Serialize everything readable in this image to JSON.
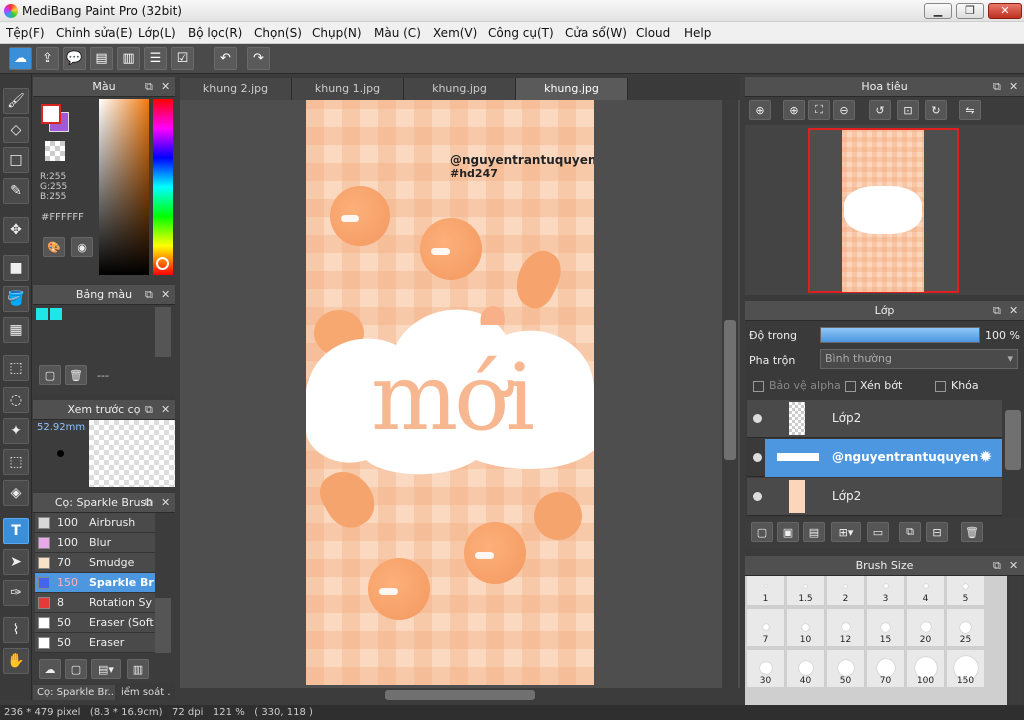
{
  "window": {
    "title": "MediBang Paint Pro (32bit)",
    "min": "▁",
    "max": "❐",
    "close": "✕"
  },
  "menu": [
    "Tệp(F)",
    "Chỉnh sửa(E)",
    "Lớp(L)",
    "Bộ lọc(R)",
    "Chọn(S)",
    "Chụp(N)",
    "Màu (C)",
    "Xem(V)",
    "Công cụ(T)",
    "Cửa sổ(W)",
    "Cloud",
    "Help"
  ],
  "tabs": [
    "khung 2.jpg",
    "khung 1.jpg",
    "khung.jpg",
    "khung.jpg"
  ],
  "colorPanel": {
    "title": "Màu",
    "r": "R:255",
    "g": "G:255",
    "b": "B:255",
    "hex": "#FFFFFF"
  },
  "palettePanel": {
    "title": "Bảng màu",
    "dash": "---"
  },
  "previewPanel": {
    "title": "Xem trước cọ",
    "size": "52.92mm"
  },
  "brushPanel": {
    "title": "Cọ: Sparkle Brush",
    "items": [
      {
        "size": "100",
        "name": "Airbrush",
        "color": "#d8d8d8"
      },
      {
        "size": "100",
        "name": "Blur",
        "color": "#e9a8e8"
      },
      {
        "size": "70",
        "name": "Smudge",
        "color": "#f7e2c7"
      },
      {
        "size": "150",
        "name": "Sparkle Br",
        "color": "#4466ee"
      },
      {
        "size": "8",
        "name": "Rotation Sy",
        "color": "#e43a3a"
      },
      {
        "size": "50",
        "name": "Eraser (Soft",
        "color": "#ffffff"
      },
      {
        "size": "50",
        "name": "Eraser",
        "color": "#ffffff"
      }
    ],
    "tab1": "Cọ: Sparkle Br...",
    "tab2": "iểm soát ."
  },
  "canvas": {
    "watermark1": "@nguyentrantuquyen",
    "watermark2": "#hd247",
    "title": "mới"
  },
  "navigator": {
    "title": "Hoa tiêu"
  },
  "layers": {
    "title": "Lớp",
    "opacity_label": "Độ trong",
    "opacity_value": "100 %",
    "opacity": 1.0,
    "blend_label": "Pha trộn",
    "blend_value": "Bình thường",
    "protect_alpha": "Bảo vệ alpha",
    "clip": "Xén bớt",
    "lock": "Khóa",
    "items": [
      {
        "name": "Lớp2"
      },
      {
        "name": "@nguyentrantuquyen"
      },
      {
        "name": "Lớp2"
      }
    ]
  },
  "brushSize": {
    "title": "Brush Size",
    "sizes": [
      "1",
      "1.5",
      "2",
      "3",
      "4",
      "5",
      "7",
      "10",
      "12",
      "15",
      "20",
      "25",
      "30",
      "40",
      "50",
      "70",
      "100",
      "150"
    ]
  },
  "status": "236 * 479 pixel   (8.3 * 16.9cm)   72 dpi   121 %   ( 330, 118 )",
  "colors": {
    "accent": "#4d97e0",
    "peach": "#f49860"
  }
}
